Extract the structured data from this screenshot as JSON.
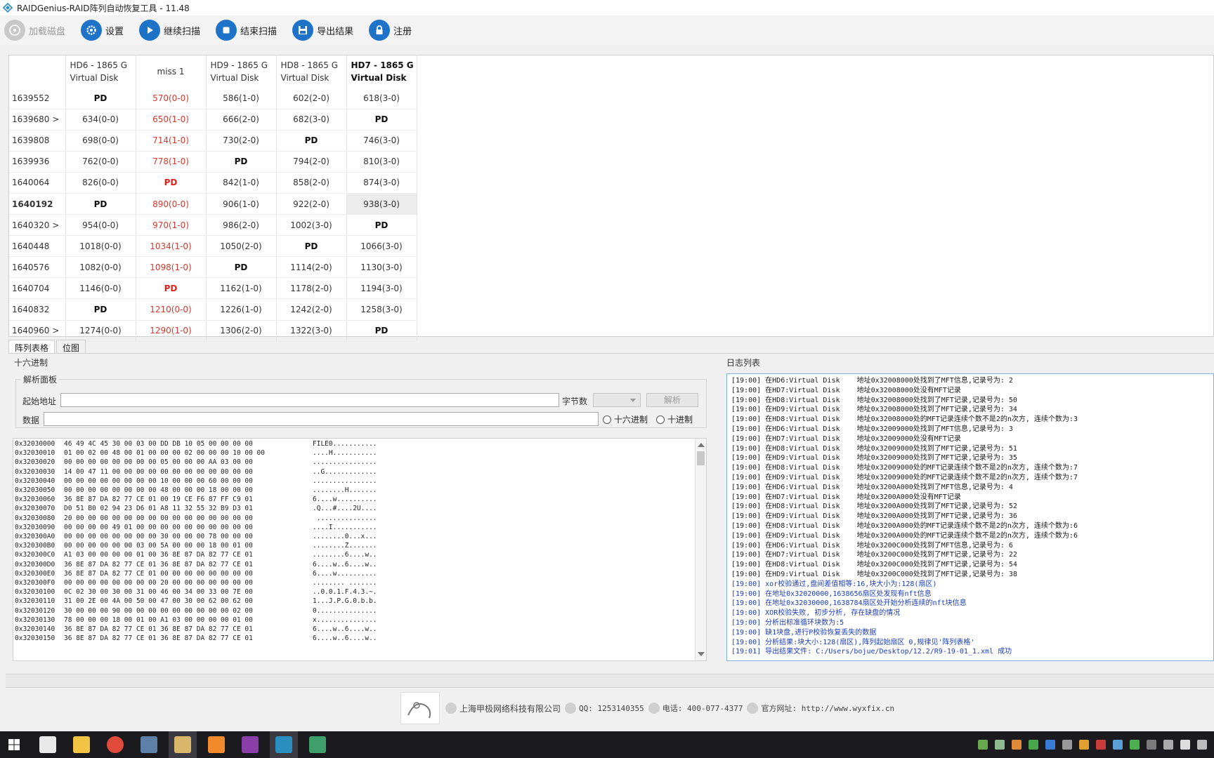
{
  "window": {
    "title": "RAIDGenius-RAID阵列自动恢复工具 - 11.48"
  },
  "toolbar": {
    "buttons": [
      {
        "label": "加载磁盘",
        "icon": "disk-icon",
        "disabled": true
      },
      {
        "label": "设置",
        "icon": "gear-icon",
        "disabled": false
      },
      {
        "label": "继续扫描",
        "icon": "play-icon",
        "disabled": false
      },
      {
        "label": "结束扫描",
        "icon": "stop-icon",
        "disabled": false
      },
      {
        "label": "导出结果",
        "icon": "save-icon",
        "disabled": false
      },
      {
        "label": "注册",
        "icon": "lock-icon",
        "disabled": false
      }
    ]
  },
  "grid": {
    "headers": [
      {
        "line1": "HD6 - 1865 G",
        "line2": "Virtual Disk"
      },
      {
        "line1": "miss 1",
        "line2": ""
      },
      {
        "line1": "HD9 - 1865 G",
        "line2": "Virtual Disk"
      },
      {
        "line1": "HD8 - 1865 G",
        "line2": "Virtual Disk"
      },
      {
        "line1": "HD7 - 1865 G",
        "line2": "Virtual Disk"
      }
    ],
    "rows": [
      {
        "label": "1639552",
        "cells": [
          "PD",
          "570(0-0)",
          "586(1-0)",
          "602(2-0)",
          "618(3-0)"
        ]
      },
      {
        "label": "1639680 >",
        "cells": [
          "634(0-0)",
          "650(1-0)",
          "666(2-0)",
          "682(3-0)",
          "PD"
        ]
      },
      {
        "label": "1639808",
        "cells": [
          "698(0-0)",
          "714(1-0)",
          "730(2-0)",
          "PD",
          "746(3-0)"
        ]
      },
      {
        "label": "1639936",
        "cells": [
          "762(0-0)",
          "778(1-0)",
          "PD",
          "794(2-0)",
          "810(3-0)"
        ]
      },
      {
        "label": "1640064",
        "cells": [
          "826(0-0)",
          "PD",
          "842(1-0)",
          "858(2-0)",
          "874(3-0)"
        ]
      },
      {
        "label": "1640192",
        "cells": [
          "PD",
          "890(0-0)",
          "906(1-0)",
          "922(2-0)",
          "938(3-0)"
        ]
      },
      {
        "label": "1640320 >",
        "cells": [
          "954(0-0)",
          "970(1-0)",
          "986(2-0)",
          "1002(3-0)",
          "PD"
        ]
      },
      {
        "label": "1640448",
        "cells": [
          "1018(0-0)",
          "1034(1-0)",
          "1050(2-0)",
          "PD",
          "1066(3-0)"
        ]
      },
      {
        "label": "1640576",
        "cells": [
          "1082(0-0)",
          "1098(1-0)",
          "PD",
          "1114(2-0)",
          "1130(3-0)"
        ]
      },
      {
        "label": "1640704",
        "cells": [
          "1146(0-0)",
          "PD",
          "1162(1-0)",
          "1178(2-0)",
          "1194(3-0)"
        ]
      },
      {
        "label": "1640832",
        "cells": [
          "PD",
          "1210(0-0)",
          "1226(1-0)",
          "1242(2-0)",
          "1258(3-0)"
        ]
      },
      {
        "label": "1640960 >",
        "cells": [
          "1274(0-0)",
          "1290(1-0)",
          "1306(2-0)",
          "1322(3-0)",
          "PD"
        ]
      }
    ]
  },
  "tabs": [
    "阵列表格",
    "位图"
  ],
  "hex": {
    "section_label": "十六进制",
    "panel_label": "解析面板",
    "start_addr_label": "起始地址",
    "bytes_label": "字节数",
    "parse_button": "解析",
    "data_label": "数据",
    "radio_hex": "十六进制",
    "radio_dec": "十进制",
    "lines": [
      {
        "addr": "0x32030000",
        "bytes": "46 49 4C 45 30 00 03 00 DD DB 10 05 00 00 00 00",
        "ascii": "FILE0..........."
      },
      {
        "addr": "0x32030010",
        "bytes": "01 00 02 00 48 00 01 00 00 00 02 00 00 00 10 00 00",
        "ascii": "....H..........."
      },
      {
        "addr": "0x32030020",
        "bytes": "00 00 00 00 00 00 00 00 05 00 00 00 AA 03 00 00",
        "ascii": "................"
      },
      {
        "addr": "0x32030030",
        "bytes": "14 00 47 11 00 00 00 00 00 00 00 00 00 00 00 00",
        "ascii": "..G............."
      },
      {
        "addr": "0x32030040",
        "bytes": "00 00 00 00 00 00 00 00 10 00 00 00 60 00 00 00",
        "ascii": "................"
      },
      {
        "addr": "0x32030050",
        "bytes": "00 00 00 00 00 00 00 00 48 00 00 00 18 00 00 00",
        "ascii": "........H......."
      },
      {
        "addr": "0x32030060",
        "bytes": "36 8E 87 DA 82 77 CE 01 00 19 CE F6 87 FF C9 01",
        "ascii": "6....w.........."
      },
      {
        "addr": "0x32030070",
        "bytes": "D0 51 B0 02 94 23 D6 01 A8 11 32 55 32 B9 D3 01",
        "ascii": ".Q...#....2U...."
      },
      {
        "addr": "0x32030080",
        "bytes": "20 00 00 00 00 00 00 00 00 00 00 00 00 00 00 00",
        "ascii": " ..............."
      },
      {
        "addr": "0x32030090",
        "bytes": "00 00 00 00 49 01 00 00 00 00 00 00 00 00 00 00",
        "ascii": "....I..........."
      },
      {
        "addr": "0x320300A0",
        "bytes": "00 00 00 00 00 00 00 00 30 00 00 00 78 00 00 00",
        "ascii": "........0...x..."
      },
      {
        "addr": "0x320300B0",
        "bytes": "00 00 00 00 00 00 03 00 5A 00 00 00 18 00 01 00",
        "ascii": "........Z......."
      },
      {
        "addr": "0x320300C0",
        "bytes": "A1 03 00 00 00 00 01 00 36 8E 87 DA 82 77 CE 01",
        "ascii": "........6....w.."
      },
      {
        "addr": "0x320300D0",
        "bytes": "36 8E 87 DA 82 77 CE 01 36 8E 87 DA 82 77 CE 01",
        "ascii": "6....w..6....w.."
      },
      {
        "addr": "0x320300E0",
        "bytes": "36 8E 87 DA 82 77 CE 01 00 00 00 00 00 00 00 00",
        "ascii": "6....w.........."
      },
      {
        "addr": "0x320300F0",
        "bytes": "00 00 00 00 00 00 00 00 20 00 00 00 00 00 00 00",
        "ascii": "........ ......."
      },
      {
        "addr": "0x32030100",
        "bytes": "0C 02 30 00 30 00 31 00 46 00 34 00 33 00 7E 00",
        "ascii": "..0.0.1.F.4.3.~."
      },
      {
        "addr": "0x32030110",
        "bytes": "31 00 2E 00 4A 00 50 00 47 00 30 00 62 00 62 00",
        "ascii": "1...J.P.G.0.b.b."
      },
      {
        "addr": "0x32030120",
        "bytes": "30 00 00 00 90 00 00 00 00 00 00 00 00 00 02 00",
        "ascii": "0..............."
      },
      {
        "addr": "0x32030130",
        "bytes": "78 00 00 00 18 00 01 00 A1 03 00 00 00 00 01 00",
        "ascii": "x..............."
      },
      {
        "addr": "0x32030140",
        "bytes": "36 8E 87 DA 82 77 CE 01 36 8E 87 DA 82 77 CE 01",
        "ascii": "6....w..6....w.."
      },
      {
        "addr": "0x32030150",
        "bytes": "36 8E 87 DA 82 77 CE 01 36 8E 87 DA 82 77 CE 01",
        "ascii": "6....w..6....w.."
      }
    ]
  },
  "log": {
    "section_label": "日志列表",
    "lines": [
      {
        "text": "[19:00] 在HD6:Virtual Disk    地址0x32008000处找到了MFT信息,记录号为: 2",
        "blue": false
      },
      {
        "text": "[19:00] 在HD7:Virtual Disk    地址0x32008000处没有MFT记录",
        "blue": false
      },
      {
        "text": "[19:00] 在HD8:Virtual Disk    地址0x32008000处找到了MFT记录,记录号为: 50",
        "blue": false
      },
      {
        "text": "[19:00] 在HD9:Virtual Disk    地址0x32008000处找到了MFT记录,记录号为: 34",
        "blue": false
      },
      {
        "text": "[19:00] 在HD8:Virtual Disk    地址0x32008000处的MFT记录连续个数不是2的n次方, 连续个数为:3",
        "blue": false
      },
      {
        "text": "[19:00] 在HD6:Virtual Disk    地址0x32009000处找到了MFT信息,记录号为: 3",
        "blue": false
      },
      {
        "text": "[19:00] 在HD7:Virtual Disk    地址0x32009000处没有MFT记录",
        "blue": false
      },
      {
        "text": "[19:00] 在HD8:Virtual Disk    地址0x32009000处找到了MFT记录,记录号为: 51",
        "blue": false
      },
      {
        "text": "[19:00] 在HD9:Virtual Disk    地址0x32009000处找到了MFT记录,记录号为: 35",
        "blue": false
      },
      {
        "text": "[19:00] 在HD8:Virtual Disk    地址0x32009000处的MFT记录连续个数不是2的n次方, 连续个数为:7",
        "blue": false
      },
      {
        "text": "[19:00] 在HD9:Virtual Disk    地址0x32009000处的MFT记录连续个数不是2的n次方, 连续个数为:7",
        "blue": false
      },
      {
        "text": "[19:00] 在HD6:Virtual Disk    地址0x3200A000处找到了MFT信息,记录号为: 4",
        "blue": false
      },
      {
        "text": "[19:00] 在HD7:Virtual Disk    地址0x3200A000处没有MFT记录",
        "blue": false
      },
      {
        "text": "[19:00] 在HD8:Virtual Disk    地址0x3200A000处找到了MFT记录,记录号为: 52",
        "blue": false
      },
      {
        "text": "[19:00] 在HD9:Virtual Disk    地址0x3200A000处找到了MFT记录,记录号为: 36",
        "blue": false
      },
      {
        "text": "[19:00] 在HD8:Virtual Disk    地址0x3200A000处的MFT记录连续个数不是2的n次方, 连续个数为:6",
        "blue": false
      },
      {
        "text": "[19:00] 在HD9:Virtual Disk    地址0x3200A000处的MFT记录连续个数不是2的n次方, 连续个数为:6",
        "blue": false
      },
      {
        "text": "[19:00] 在HD6:Virtual Disk    地址0x3200C000处找到了MFT信息,记录号为: 6",
        "blue": false
      },
      {
        "text": "[19:00] 在HD7:Virtual Disk    地址0x3200C000处找到了MFT记录,记录号为: 22",
        "blue": false
      },
      {
        "text": "[19:00] 在HD8:Virtual Disk    地址0x3200C000处找到了MFT记录,记录号为: 54",
        "blue": false
      },
      {
        "text": "[19:00] 在HD9:Virtual Disk    地址0x3200C000处找到了MFT记录,记录号为: 38",
        "blue": false
      },
      {
        "text": "[19:00] xor校验通过,盘间差值相等:16,块大小为:128(扇区)",
        "blue": true
      },
      {
        "text": "[19:00] 在地址0x32020000,1638656扇区处发现有nft信息",
        "blue": true
      },
      {
        "text": "[19:00] 在地址0x32030000,1638784扇区处开始分析连续的nft块信息",
        "blue": true
      },
      {
        "text": "[19:00] XOR校验失败, 初步分析, 存在缺盘的情况",
        "blue": true
      },
      {
        "text": "[19:00] 分析出标准循环块数为:5",
        "blue": true
      },
      {
        "text": "[19:00] 缺1块盘,进行P校验恢复丢失的数据",
        "blue": true
      },
      {
        "text": "[19:00] 分析结果:块大小:128(扇区),阵列起始扇区 0,规律见'阵列表格'",
        "blue": true
      },
      {
        "text": "[19:01] 导出结果文件: C:/Users/bojue/Desktop/12.2/R9-19-01_1.xml 成功",
        "blue": true
      }
    ]
  },
  "footer": {
    "company": "上海甲极网络科技有限公司",
    "qq": "QQ: 1253140355",
    "phone": "电话: 400-077-4377",
    "website": "官方网址: http://www.wyxfix.cn"
  },
  "colors": {
    "accent": "#1e73c9",
    "miss": "#d23b2f",
    "log_blue": "#1a3cb8"
  }
}
